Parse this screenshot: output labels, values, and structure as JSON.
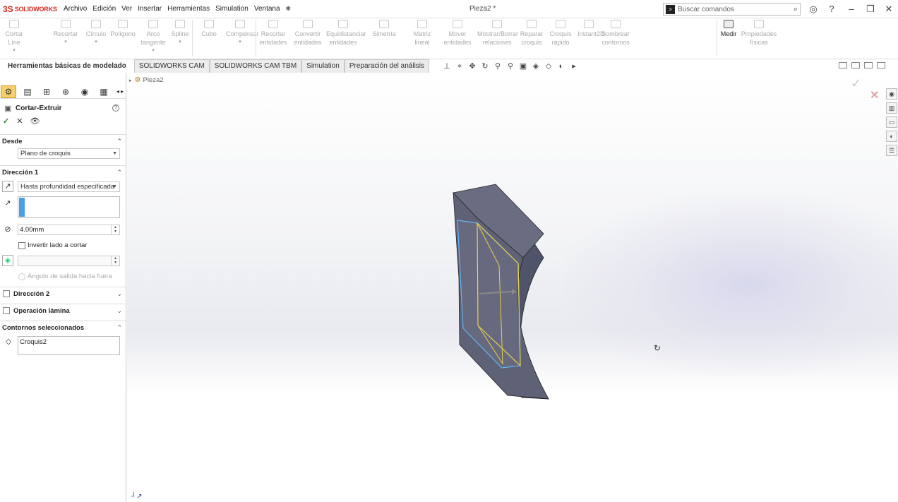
{
  "app": {
    "logo_mark": "3S",
    "logo_word": "SOLIDWORKS"
  },
  "menu": [
    "Archivo",
    "Edición",
    "Ver",
    "Insertar",
    "Herramientas",
    "Simulation",
    "Ventana"
  ],
  "document_title": "Pieza2 *",
  "search": {
    "placeholder": "Buscar comandos"
  },
  "ribbon": [
    "Cortar Líne",
    "Recortar",
    "Círculo",
    "Polígono",
    "Arco tangente",
    "Spline",
    "Cubo",
    "Compensar",
    "Recortar entidades",
    "Convertir entidades",
    "Equidistanciar entidades",
    "Simetría",
    "Matriz lineal",
    "Mover entidades",
    "Mostrar/Borrar relaciones",
    "Reparar croquis",
    "Croquis rápido",
    "Instant2D",
    "Sombrear contornos",
    "Medir",
    "Propiedades físicas"
  ],
  "ribbon_active": "Medir",
  "tabs": [
    "Herramientas básicas de modelado",
    "SOLIDWORKS CAM",
    "SOLIDWORKS CAM TBM",
    "Simulation",
    "Preparación del análisis"
  ],
  "feature_tree": {
    "root": "Pieza2"
  },
  "property_manager": {
    "title": "Cortar-Extruir",
    "desde": {
      "label": "Desde",
      "value": "Plano de croquis"
    },
    "direccion1": {
      "label": "Dirección 1",
      "end_condition": "Hasta profundidad especificada",
      "depth": "4.00mm",
      "flip_label": "Invertir lado a cortar",
      "draft_label": "Ángulo de salida hacia fuera"
    },
    "direccion2": {
      "label": "Dirección 2"
    },
    "thin": {
      "label": "Operación lámina"
    },
    "contours": {
      "label": "Contornos seleccionados",
      "value": "Croquis2"
    }
  },
  "colors": {
    "accent": "#4a9ee3",
    "brand": "#d52b1e",
    "model_face": "#5c6075",
    "sketch": "#e7d24a",
    "edge_select": "#60b4f0"
  }
}
